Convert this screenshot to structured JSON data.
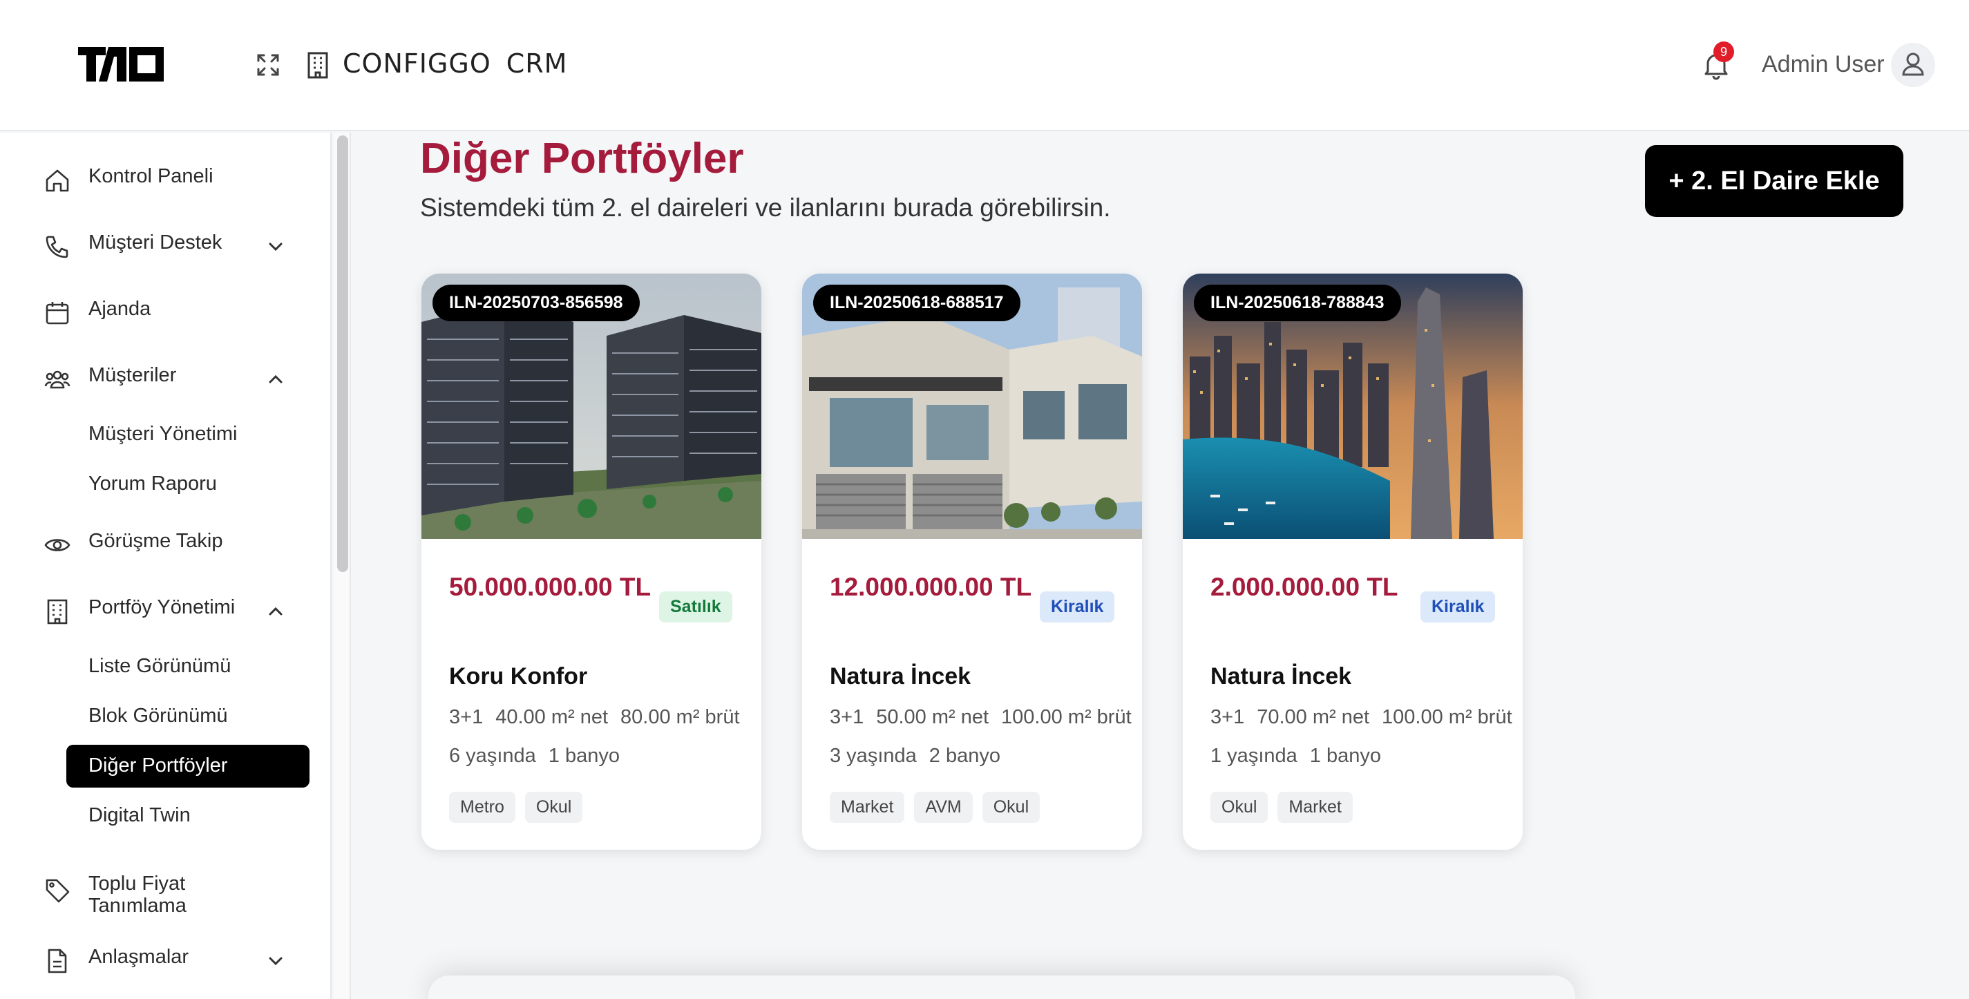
{
  "header": {
    "brand_word1": "CONFIGGO",
    "brand_word2": "CRM",
    "notification_count": "9",
    "user_name": "Admin User"
  },
  "icons": {
    "logo": "tno-logo",
    "expand": "expand-icon",
    "building": "building-icon",
    "bell": "bell-icon",
    "user": "user-icon"
  },
  "sidebar": {
    "items": [
      {
        "label": "Kontrol Paneli",
        "icon": "home-icon"
      },
      {
        "label": "Müşteri Destek",
        "icon": "phone-icon",
        "expandable": true,
        "expanded": false
      },
      {
        "label": "Ajanda",
        "icon": "calendar-icon"
      },
      {
        "label": "Müşteriler",
        "icon": "users-icon",
        "expandable": true,
        "expanded": true
      },
      {
        "label": "Görüşme Takip",
        "icon": "eye-icon"
      },
      {
        "label": "Portföy Yönetimi",
        "icon": "building-icon",
        "expandable": true,
        "expanded": true
      },
      {
        "label": "Toplu Fiyat Tanımlama",
        "icon": "tag-icon"
      },
      {
        "label": "Anlaşmalar",
        "icon": "document-icon",
        "expandable": true,
        "expanded": false
      }
    ],
    "customers_sub": [
      "Müşteri Yönetimi",
      "Yorum Raporu"
    ],
    "portfolio_sub": [
      "Liste Görünümü",
      "Blok Görünümü",
      "Diğer Portföyler",
      "Digital Twin"
    ],
    "active_item": "Diğer Portföyler"
  },
  "main": {
    "title": "Diğer Portföyler",
    "subtitle": "Sistemdeki tüm 2. el daireleri ve ilanlarını burada görebilirsin.",
    "add_button": "+ 2. El Daire Ekle"
  },
  "listings": [
    {
      "code": "ILN-20250703-856598",
      "price": "50.000.000.00 TL",
      "status": "Satılık",
      "status_type": "sale",
      "name": "Koru Konfor",
      "rooms": "3+1",
      "net": "40.00 m² net",
      "gross": "80.00 m² brüt",
      "age": "6 yaşında",
      "baths": "1 banyo",
      "tags": [
        "Metro",
        "Okul"
      ],
      "image": "residential-towers-photo"
    },
    {
      "code": "ILN-20250618-688517",
      "price": "12.000.000.00 TL",
      "status": "Kiralık",
      "status_type": "rent",
      "name": "Natura İncek",
      "rooms": "3+1",
      "net": "50.00 m² net",
      "gross": "100.00 m² brüt",
      "age": "3 yaşında",
      "baths": "2 banyo",
      "tags": [
        "Market",
        "AVM",
        "Okul"
      ],
      "image": "modern-villa-photo"
    },
    {
      "code": "ILN-20250618-788843",
      "price": "2.000.000.00 TL",
      "status": "Kiralık",
      "status_type": "rent",
      "name": "Natura İncek",
      "rooms": "3+1",
      "net": "70.00 m² net",
      "gross": "100.00 m² brüt",
      "age": "1 yaşında",
      "baths": "1 banyo",
      "tags": [
        "Okul",
        "Market"
      ],
      "image": "marina-skyline-photo"
    }
  ],
  "colors": {
    "accent": "#a41b3c",
    "sale_bg": "#def5e6",
    "sale_text": "#157a3c",
    "rent_bg": "#dce9fb",
    "rent_text": "#1f4fb7",
    "active_nav": "#000000"
  }
}
